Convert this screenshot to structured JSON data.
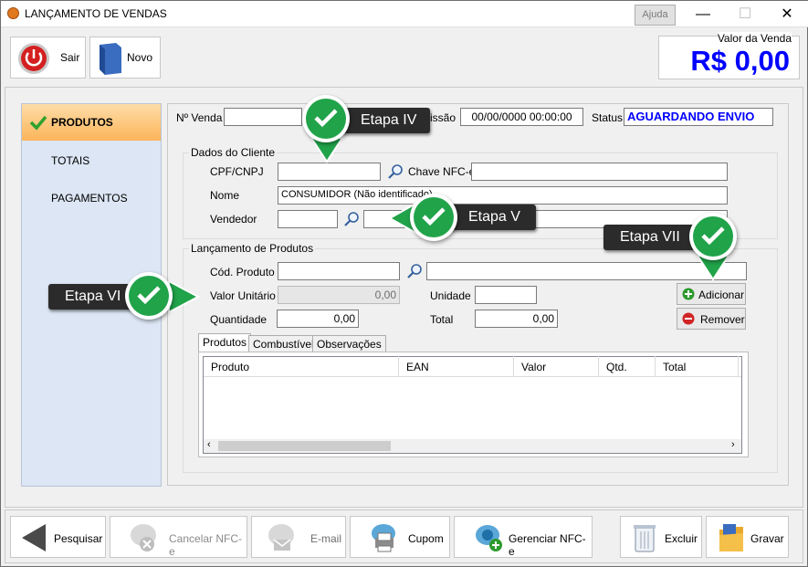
{
  "window": {
    "title": "LANÇAMENTO DE VENDAS",
    "help_label": "Ajuda",
    "minimize": "—",
    "maximize": "☐",
    "close": "✕"
  },
  "toolbar": {
    "exit_label": "Sair",
    "new_label": "Novo"
  },
  "total_box": {
    "label": "Valor da Venda",
    "value": "R$ 0,00"
  },
  "nav": {
    "items": [
      {
        "label": "PRODUTOS"
      },
      {
        "label": "TOTAIS"
      },
      {
        "label": "PAGAMENTOS"
      }
    ]
  },
  "sale": {
    "number_label": "Nº Venda",
    "number_value": "",
    "emission_label": "issão",
    "emission_value": "00/00/0000 00:00:00",
    "status_label": "Status",
    "status_value": "AGUARDANDO ENVIO"
  },
  "client": {
    "group_label": "Dados do Cliente",
    "cpf_label": "CPF/CNPJ",
    "cpf_value": "",
    "nfce_key_label": "Chave NFC-e",
    "nfce_key_value": "",
    "name_label": "Nome",
    "name_value": "CONSUMIDOR (Não identificado)",
    "seller_label": "Vendedor",
    "seller_code": "",
    "seller_name": ""
  },
  "product_entry": {
    "group_label": "Lançamento de Produtos",
    "code_label": "Cód. Produto",
    "code_value": "",
    "description_value": "",
    "unit_price_label": "Valor Unitário",
    "unit_price_value": "0,00",
    "unit_label": "Unidade",
    "unit_value": "",
    "qty_label": "Quantidade",
    "qty_value": "0,00",
    "total_label": "Total",
    "total_value": "0,00",
    "add_label": "Adicionar",
    "remove_label": "Remover"
  },
  "tabs": [
    {
      "label": "Produtos"
    },
    {
      "label": "Combustível"
    },
    {
      "label": "Observações"
    }
  ],
  "grid": {
    "columns": [
      "Produto",
      "EAN",
      "Valor",
      "Qtd.",
      "Total"
    ],
    "rows": []
  },
  "bottom": {
    "search_label": "Pesquisar",
    "cancel_label": "Cancelar NFC-e",
    "email_label": "E-mail",
    "coupon_label": "Cupom",
    "manage_label": "Gerenciar NFC-e",
    "delete_label": "Excluir",
    "save_label": "Gravar"
  },
  "callouts": {
    "iv": "Etapa IV",
    "v": "Etapa V",
    "vi": "Etapa VI",
    "vii": "Etapa VII"
  },
  "colors": {
    "accent_blue": "#0000ff",
    "nav_active": "#fdc57a",
    "callout_green": "#21a34a"
  }
}
